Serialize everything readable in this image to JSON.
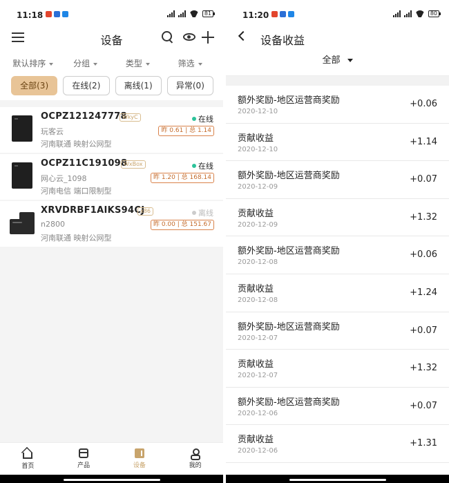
{
  "left": {
    "status": {
      "time": "11:18",
      "battery": "81"
    },
    "header": {
      "title": "设备"
    },
    "filters": [
      "默认排序",
      "分组",
      "类型",
      "筛选"
    ],
    "chips": [
      {
        "label": "全部(3)",
        "active": true
      },
      {
        "label": "在线(2)",
        "active": false
      },
      {
        "label": "离线(1)",
        "active": false
      },
      {
        "label": "异常(0)",
        "active": false
      }
    ],
    "devices": [
      {
        "name": "OCPZ121247778",
        "tag": "WkyC",
        "status": "在线",
        "status_color": "#2cc29a",
        "sub": "玩客云",
        "location": "河南联通  映射公网型",
        "earnings": "昨 0.61 | 总 1.14"
      },
      {
        "name": "OCPZ11C191098",
        "tag": "WxBox",
        "status": "在线",
        "status_color": "#2cc29a",
        "sub": "网心云_1098",
        "location": "河南电信  端口限制型",
        "earnings": "昨 1.20 | 总 168.14"
      },
      {
        "name": "XRVDRBF1AIKS94CJ",
        "tag": "x86",
        "status": "离线",
        "status_color": "#cccccc",
        "sub": "n2800",
        "location": "河南联通  映射公网型",
        "earnings": "昨 0.00 | 总 151.67"
      }
    ],
    "tabs": [
      {
        "label": "首页",
        "icon": "home-icon"
      },
      {
        "label": "产品",
        "icon": "box-icon"
      },
      {
        "label": "设备",
        "icon": "device-icon"
      },
      {
        "label": "我的",
        "icon": "user-icon"
      }
    ]
  },
  "right": {
    "status": {
      "time": "11:20",
      "battery": "80"
    },
    "header": {
      "title": "设备收益"
    },
    "scope": "全部",
    "records": [
      {
        "title": "额外奖励-地区运营商奖励",
        "date": "2020-12-10",
        "amount": "+0.06"
      },
      {
        "title": "贡献收益",
        "date": "2020-12-10",
        "amount": "+1.14"
      },
      {
        "title": "额外奖励-地区运营商奖励",
        "date": "2020-12-09",
        "amount": "+0.07"
      },
      {
        "title": "贡献收益",
        "date": "2020-12-09",
        "amount": "+1.32"
      },
      {
        "title": "额外奖励-地区运营商奖励",
        "date": "2020-12-08",
        "amount": "+0.06"
      },
      {
        "title": "贡献收益",
        "date": "2020-12-08",
        "amount": "+1.24"
      },
      {
        "title": "额外奖励-地区运营商奖励",
        "date": "2020-12-07",
        "amount": "+0.07"
      },
      {
        "title": "贡献收益",
        "date": "2020-12-07",
        "amount": "+1.32"
      },
      {
        "title": "额外奖励-地区运营商奖励",
        "date": "2020-12-06",
        "amount": "+0.07"
      },
      {
        "title": "贡献收益",
        "date": "2020-12-06",
        "amount": "+1.31"
      }
    ]
  }
}
